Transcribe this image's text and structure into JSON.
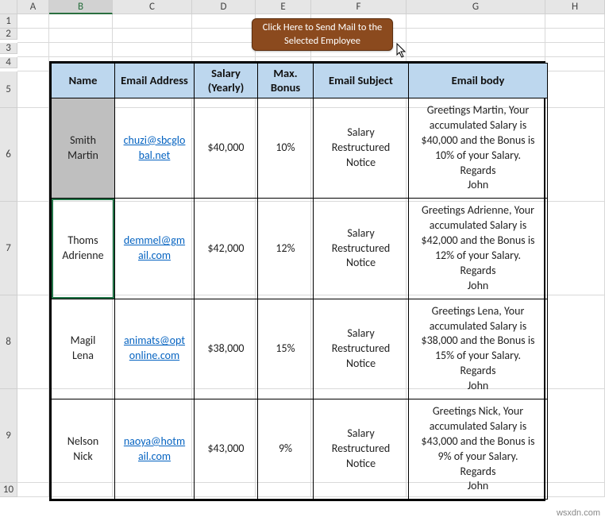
{
  "columns": [
    "A",
    "B",
    "C",
    "D",
    "E",
    "F",
    "G",
    "H"
  ],
  "rows": [
    "1",
    "2",
    "3",
    "4",
    "5",
    "6",
    "7",
    "8",
    "9",
    "10"
  ],
  "selected_col": "B",
  "button_label": "Click Here to Send Mail to the Selected Employee",
  "headers": {
    "name": "Name",
    "email": "Email Address",
    "salary": "Salary (Yearly)",
    "bonus": "Max. Bonus",
    "subject": "Email Subject",
    "body": "Email body"
  },
  "data": [
    {
      "name": "Smith Martin",
      "email": "chuzi@sbcglobal.net",
      "salary": "$40,000",
      "bonus": "10%",
      "subject": "Salary Restructured Notice",
      "body": "Greetings Martin, Your accumulated Salary is $40,000 and the Bonus is 10% of your Salary. Regards John"
    },
    {
      "name": "Thoms Adrienne",
      "email": "demmel@gmail.com",
      "salary": "$42,000",
      "bonus": "12%",
      "subject": "Salary Restructured Notice",
      "body": "Greetings Adrienne, Your accumulated Salary is $42,000 and the Bonus is 12% of your Salary. Regards John"
    },
    {
      "name": "Magil Lena",
      "email": "animats@optonline.com",
      "salary": "$38,000",
      "bonus": "15%",
      "subject": "Salary Restructured Notice",
      "body": "Greetings Lena, Your accumulated Salary is $38,000 and the Bonus is 15% of your Salary. Regards John"
    },
    {
      "name": "Nelson Nick",
      "email": "naoya@hotmail.com",
      "salary": "$43,000",
      "bonus": "9%",
      "subject": "Salary Restructured Notice",
      "body": "Greetings Nick, Your accumulated Salary is $43,000 and the Bonus is 9% of your Salary. Regards John"
    }
  ],
  "watermark": "wsxdn.com"
}
